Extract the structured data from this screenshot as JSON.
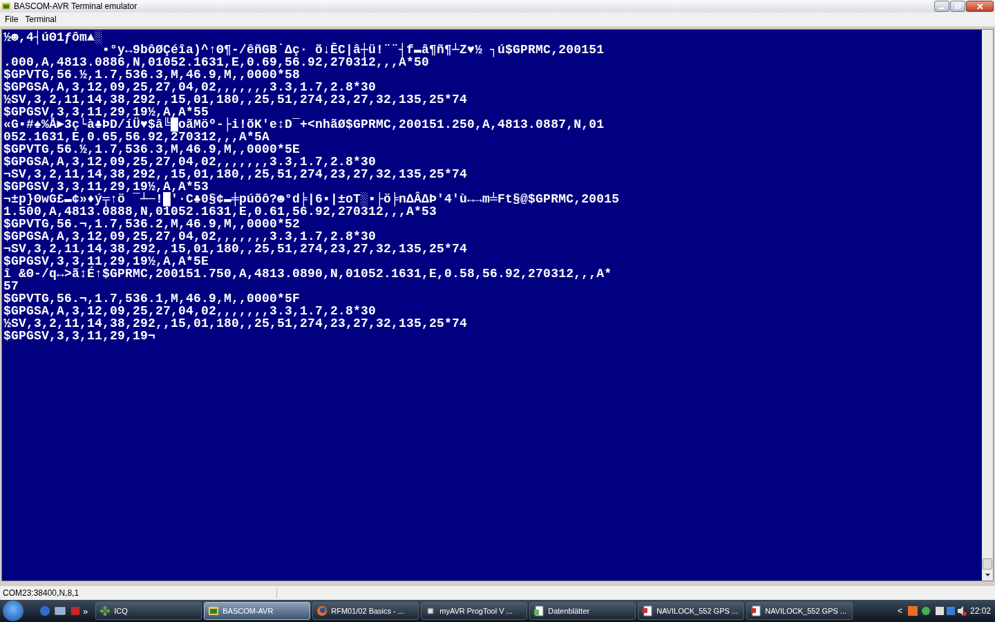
{
  "window": {
    "title": "BASCOM-AVR Terminal emulator"
  },
  "menu": [
    {
      "label": "File"
    },
    {
      "label": "Terminal"
    }
  ],
  "terminal": {
    "lines": [
      "½☻,4┤úΘ1ƒôm▲░",
      "             ▪°y↔9bôØÇéîa)^↑Θ¶-/êñGB˙Δç· õ↓ĒC|â┼ü!¨¨┤f▬â¶ñ¶┴Z♥½ ┐ú$GPRMC,200151",
      ".000,A,4813.0886,N,01052.1631,E,0.69,56.92,270312,,,A*50",
      "$GPVTG,56.½,1.7,536.3,M,46.9,M,,0000*58",
      "$GPGSA,A,3,12,09,25,27,04,02,,,,,,,3.3,1.7,2.8*30",
      "½SV,3,2,11,14,38,292,,15,01,180,,25,51,274,23,27,32,135,25*74",
      "$GPGSV,3,3,11,29,19½,A,A*55",
      "«G▪#♠%Å►3ç└à♣ÞD/íÜ♥$â╚█oãMöº-├i!õK'e↕D¯+<nhãØ$GPRMC,200151.250,A,4813.0887,N,01",
      "052.1631,E,0.65,56.92,270312,,,A*5A",
      "$GPVTG,56.½,1.7,536.3,M,46.9,M,,0000*5E",
      "$GPGSA,A,3,12,09,25,27,04,02,,,,,,,3.3,1.7,2.8*30",
      "¬SV,3,2,11,14,38,292,,15,01,180,,25,51,274,23,27,32,135,25*74",
      "$GPGSV,3,3,11,29,19½,A,A*53",
      "¬±p}ΘwG£▬¢»♦ý╤↑ö ¯┴─!█'·C♣0§¢▬╪púõô?☻°d╞|6▪|±oT░▪├ö╞nΔÂΔÞ'4'ù↔→m╧Ft§@$GPRMC,20015",
      "1.500,A,4813.0888,N,01052.1631,E,0.61,56.92,270312,,,A*53",
      "$GPVTG,56.¬,1.7,536.2,M,46.9,M,,0000*52",
      "$GPGSA,A,3,12,09,25,27,04,02,,,,,,,3.3,1.7,2.8*30",
      "¬SV,3,2,11,14,38,292,,15,01,180,,25,51,274,23,27,32,135,25*74",
      "$GPGSV,3,3,11,29,19½,A,A*5E",
      "î &Θ-/q↔>ã↕É↑$GPRMC,200151.750,A,4813.0890,N,01052.1631,E,0.58,56.92,270312,,,A*",
      "57",
      "$GPVTG,56.¬,1.7,536.1,M,46.9,M,,0000*5F",
      "$GPGSA,A,3,12,09,25,27,04,02,,,,,,,3.3,1.7,2.8*30",
      "½SV,3,2,11,14,38,292,,15,01,180,,25,51,274,23,27,32,135,25*74",
      "$GPGSV,3,3,11,29,19¬"
    ]
  },
  "status_bar": {
    "text": "COM23:38400,N,8,1"
  },
  "taskbar": {
    "overflow": "»",
    "tasks": [
      {
        "label": "ICQ",
        "kind": "flower",
        "selected": false
      },
      {
        "label": "BASCOM-AVR",
        "kind": "app",
        "selected": true
      },
      {
        "label": "RFM01/02 Basics - ...",
        "kind": "browser",
        "selected": false
      },
      {
        "label": "myAVR ProgTool V ...",
        "kind": "tool",
        "selected": false
      },
      {
        "label": "Datenblätter",
        "kind": "folder",
        "selected": false
      },
      {
        "label": "NAVILOCK_552 GPS ...",
        "kind": "pdf",
        "selected": false
      },
      {
        "label": "NAVILOCK_552 GPS ...",
        "kind": "pdf",
        "selected": false
      }
    ],
    "tray_toggle": "<",
    "clock": "22:02"
  }
}
